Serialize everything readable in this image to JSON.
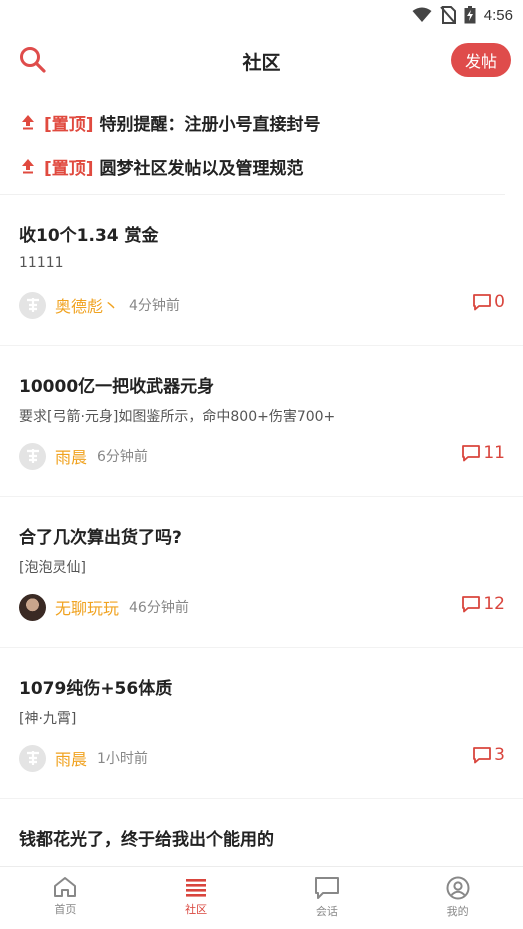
{
  "status_bar": {
    "time": "4:56"
  },
  "header": {
    "title": "社区",
    "post_button": "发帖"
  },
  "pinned": [
    {
      "tag": "[置顶]",
      "text": "特别提醒：注册小号直接封号"
    },
    {
      "tag": "[置顶]",
      "text": "圆梦社区发帖以及管理规范"
    }
  ],
  "posts": [
    {
      "title": "收10个1.34 赏金",
      "subtitle": "11111",
      "author": "奥德彪丶",
      "time": "4分钟前",
      "comments": "0"
    },
    {
      "title": "10000亿一把收武器元身",
      "subtitle": "要求[弓箭·元身]如图鉴所示，命中800+伤害700+",
      "author": "雨晨",
      "time": "6分钟前",
      "comments": "11"
    },
    {
      "title": "合了几次算出货了吗?",
      "subtitle": "[泡泡灵仙]",
      "author": "无聊玩玩",
      "time": "46分钟前",
      "comments": "12"
    },
    {
      "title": "1079纯伤+56体质",
      "subtitle": "[神·九霄]",
      "author": "雨晨",
      "time": "1小时前",
      "comments": "3"
    },
    {
      "title": "钱都花光了，终于给我出个能用的"
    }
  ],
  "tabbar": [
    {
      "label": "首页",
      "icon": "home-icon"
    },
    {
      "label": "社区",
      "icon": "list-icon"
    },
    {
      "label": "会话",
      "icon": "chat-icon"
    },
    {
      "label": "我的",
      "icon": "user-icon"
    }
  ],
  "colors": {
    "accent": "#df4c4b",
    "author": "#f0a21f",
    "text": "#222222"
  }
}
